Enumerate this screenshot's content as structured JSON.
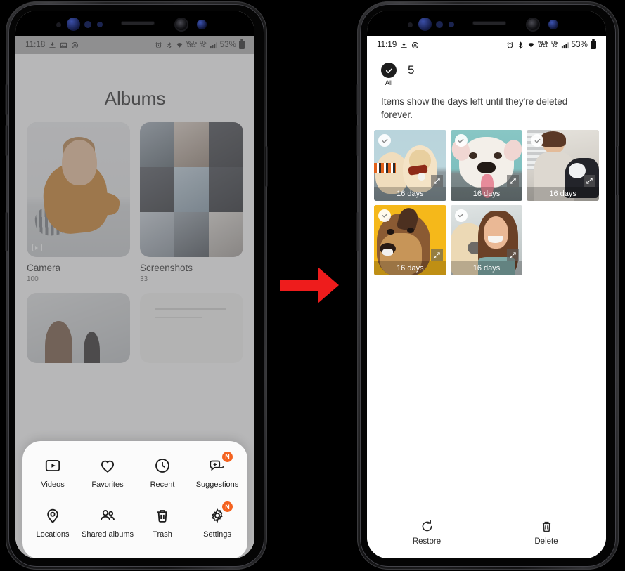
{
  "left_phone": {
    "status_bar": {
      "time": "11:18",
      "left_icons": [
        "download-icon",
        "image-icon",
        "drive-icon"
      ],
      "right_icons": [
        "alarm-icon",
        "bluetooth-icon",
        "wifi-icon",
        "volte-icon",
        "lte-icon",
        "signal-icon"
      ],
      "volte_label_top": "VoLTE",
      "volte_label_bottom": "LTE1",
      "lte_label_top": "LTE",
      "lte_label_bottom": "4G",
      "battery_percent": "53%"
    },
    "page_title": "Albums",
    "albums": [
      {
        "name": "Camera",
        "count": "100",
        "has_video_badge": true
      },
      {
        "name": "Screenshots",
        "count": "33",
        "has_video_badge": false
      }
    ],
    "sheet_menu": [
      {
        "label": "Videos",
        "icon": "video-icon",
        "badge": ""
      },
      {
        "label": "Favorites",
        "icon": "heart-icon",
        "badge": ""
      },
      {
        "label": "Recent",
        "icon": "clock-icon",
        "badge": ""
      },
      {
        "label": "Suggestions",
        "icon": "suggestions-icon",
        "badge": "N"
      },
      {
        "label": "Locations",
        "icon": "location-pin-icon",
        "badge": ""
      },
      {
        "label": "Shared albums",
        "icon": "people-icon",
        "badge": ""
      },
      {
        "label": "Trash",
        "icon": "trash-icon",
        "badge": ""
      },
      {
        "label": "Settings",
        "icon": "gear-icon",
        "badge": "N"
      }
    ]
  },
  "right_phone": {
    "status_bar": {
      "time": "11:19",
      "left_icons": [
        "download-icon",
        "drive-icon"
      ],
      "right_icons": [
        "alarm-icon",
        "bluetooth-icon",
        "wifi-icon",
        "volte-icon",
        "lte-icon",
        "signal-icon"
      ],
      "volte_label_top": "VoLTE",
      "volte_label_bottom": "LTE1",
      "lte_label_top": "LTE",
      "lte_label_bottom": "4G",
      "battery_percent": "53%"
    },
    "select_all_label": "All",
    "selected_count": "5",
    "info_text": "Items show the days left until they're deleted forever.",
    "tiles": [
      {
        "days_label": "16 days",
        "subject": "two-golden-retriever-puppies",
        "selected": true
      },
      {
        "days_label": "16 days",
        "subject": "white-bulldog",
        "selected": true
      },
      {
        "days_label": "16 days",
        "subject": "woman-hugging-husky",
        "selected": true
      },
      {
        "days_label": "16 days",
        "subject": "brown-dog-yellow-background",
        "selected": true
      },
      {
        "days_label": "16 days",
        "subject": "woman-with-golden-retriever",
        "selected": true
      }
    ],
    "bottom_actions": [
      {
        "label": "Restore",
        "icon": "restore-icon"
      },
      {
        "label": "Delete",
        "icon": "trash-icon"
      }
    ]
  },
  "transition_arrow": {
    "name": "right-arrow",
    "color": "#ee1c1c"
  }
}
